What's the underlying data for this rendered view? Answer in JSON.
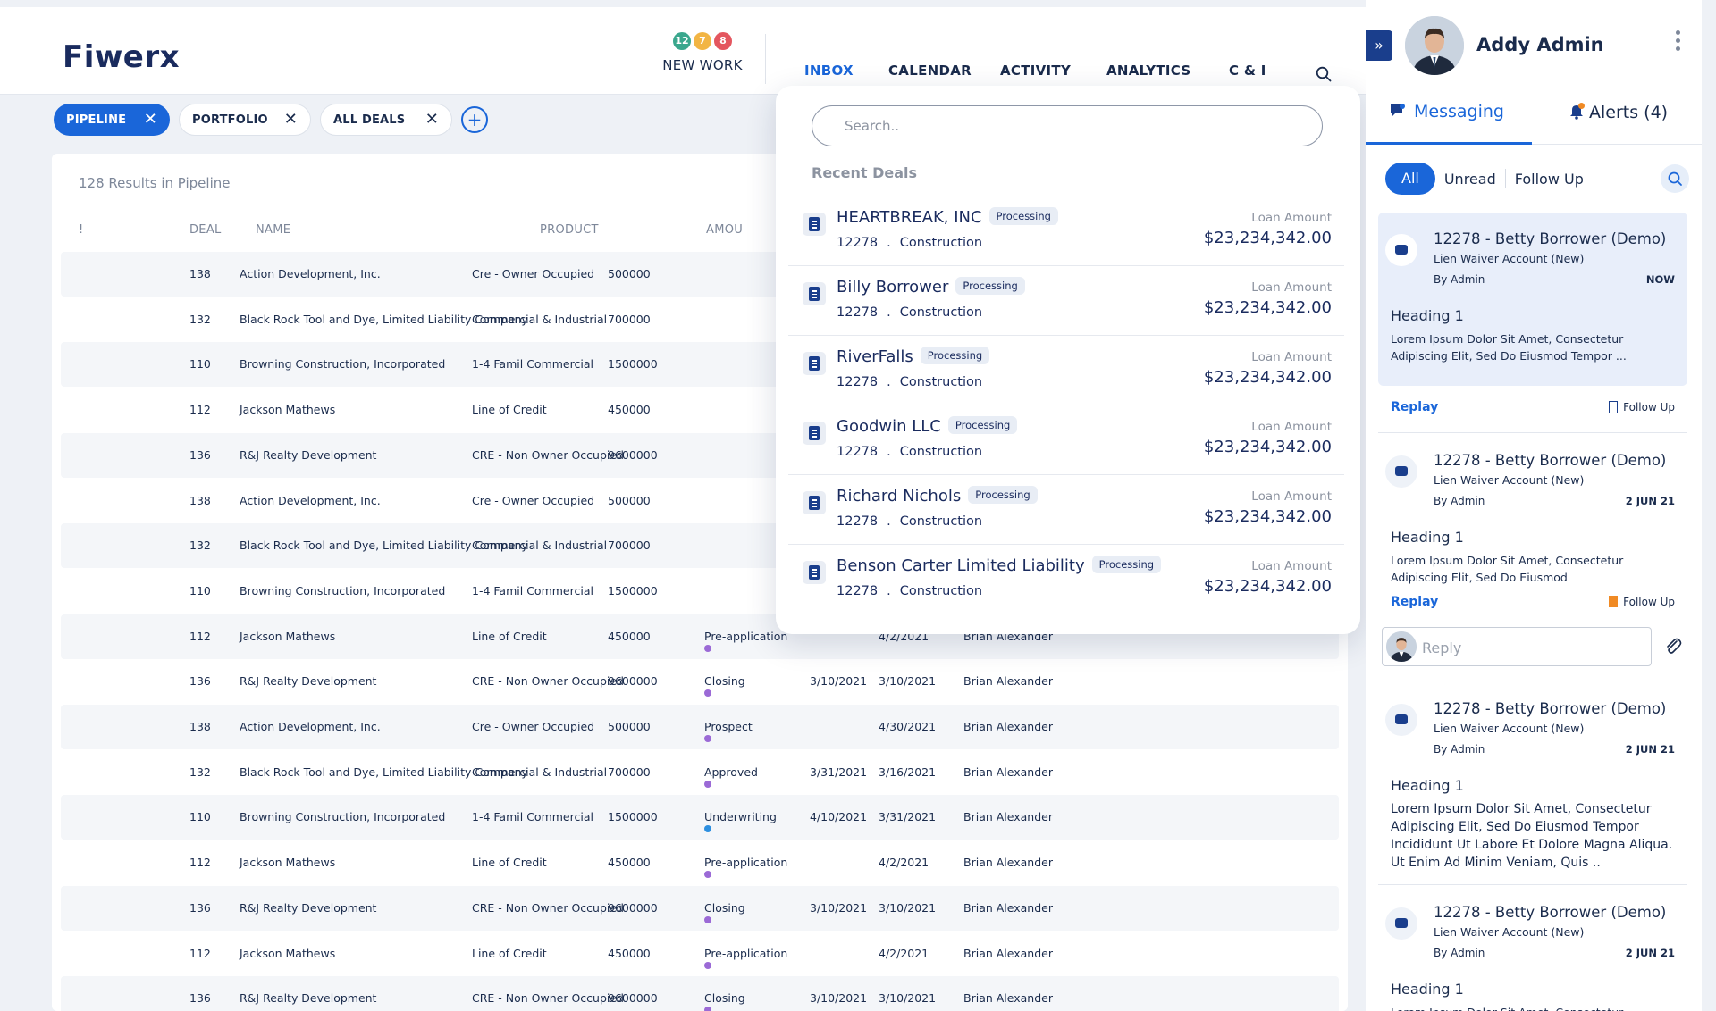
{
  "app": {
    "logo": "Fiwerx"
  },
  "header": {
    "new_work": {
      "label": "NEW WORK",
      "badges": [
        {
          "count": "12",
          "color": "#3aa78d"
        },
        {
          "count": "7",
          "color": "#f2b544"
        },
        {
          "count": "8",
          "color": "#e4565f"
        }
      ]
    },
    "tabs": [
      "INBOX",
      "CALENDAR",
      "ACTIVITY",
      "ANALYTICS",
      "C & I"
    ],
    "active_tab": "INBOX"
  },
  "filters": [
    {
      "label": "PIPELINE",
      "active": true
    },
    {
      "label": "PORTFOLIO",
      "active": false
    },
    {
      "label": "ALL DEALS",
      "active": false
    }
  ],
  "table": {
    "results": "128 Results in Pipeline",
    "columns": [
      "!",
      "DEAL",
      "NAME",
      "PRODUCT",
      "AMOU"
    ],
    "rows": [
      {
        "deal": "138",
        "name": "Action Development, Inc.",
        "product": "Cre - Owner Occupied",
        "amount": "500000",
        "status": "",
        "status_color": "",
        "date1": "",
        "date2": "",
        "owner": ""
      },
      {
        "deal": "132",
        "name": "Black Rock Tool and Dye, Limited Liability Company",
        "product": "Commercial & Industrial",
        "amount": "700000",
        "status": "",
        "status_color": "",
        "date1": "",
        "date2": "",
        "owner": ""
      },
      {
        "deal": "110",
        "name": "Browning Construction, Incorporated",
        "product": "1-4 Famil Commercial",
        "amount": "1500000",
        "status": "",
        "status_color": "",
        "date1": "",
        "date2": "",
        "owner": ""
      },
      {
        "deal": "112",
        "name": "Jackson Mathews",
        "product": "Line of Credit",
        "amount": "450000",
        "status": "",
        "status_color": "",
        "date1": "",
        "date2": "",
        "owner": ""
      },
      {
        "deal": "136",
        "name": "R&J Realty Development",
        "product": "CRE - Non Owner Occupied",
        "amount": "9600000",
        "status": "",
        "status_color": "",
        "date1": "",
        "date2": "",
        "owner": ""
      },
      {
        "deal": "138",
        "name": "Action Development, Inc.",
        "product": "Cre - Owner Occupied",
        "amount": "500000",
        "status": "",
        "status_color": "",
        "date1": "",
        "date2": "",
        "owner": ""
      },
      {
        "deal": "132",
        "name": "Black Rock Tool and Dye, Limited Liability Company",
        "product": "Commercial & Industrial",
        "amount": "700000",
        "status": "",
        "status_color": "",
        "date1": "",
        "date2": "",
        "owner": ""
      },
      {
        "deal": "110",
        "name": "Browning Construction, Incorporated",
        "product": "1-4 Famil Commercial",
        "amount": "1500000",
        "status": "",
        "status_color": "",
        "date1": "",
        "date2": "",
        "owner": ""
      },
      {
        "deal": "112",
        "name": "Jackson Mathews",
        "product": "Line of Credit",
        "amount": "450000",
        "status": "Pre-application",
        "status_color": "#9b6ad6",
        "date1": "",
        "date2": "4/2/2021",
        "owner": "Brian Alexander"
      },
      {
        "deal": "136",
        "name": "R&J Realty Development",
        "product": "CRE - Non Owner Occupied",
        "amount": "9600000",
        "status": "Closing",
        "status_color": "#9b6ad6",
        "date1": "3/10/2021",
        "date2": "3/10/2021",
        "owner": "Brian Alexander"
      },
      {
        "deal": "138",
        "name": "Action Development, Inc.",
        "product": "Cre - Owner Occupied",
        "amount": "500000",
        "status": "Prospect",
        "status_color": "#9b6ad6",
        "date1": "",
        "date2": "4/30/2021",
        "owner": "Brian Alexander"
      },
      {
        "deal": "132",
        "name": "Black Rock Tool and Dye, Limited Liability Company",
        "product": "Commercial & Industrial",
        "amount": "700000",
        "status": "Approved",
        "status_color": "#9b6ad6",
        "date1": "3/31/2021",
        "date2": "3/16/2021",
        "owner": "Brian Alexander"
      },
      {
        "deal": "110",
        "name": "Browning Construction, Incorporated",
        "product": "1-4 Famil Commercial",
        "amount": "1500000",
        "status": "Underwriting",
        "status_color": "#2d8fe0",
        "date1": "4/10/2021",
        "date2": "3/31/2021",
        "owner": "Brian Alexander"
      },
      {
        "deal": "112",
        "name": "Jackson Mathews",
        "product": "Line of Credit",
        "amount": "450000",
        "status": "Pre-application",
        "status_color": "#9b6ad6",
        "date1": "",
        "date2": "4/2/2021",
        "owner": "Brian Alexander"
      },
      {
        "deal": "136",
        "name": "R&J Realty Development",
        "product": "CRE - Non Owner Occupied",
        "amount": "9600000",
        "status": "Closing",
        "status_color": "#9b6ad6",
        "date1": "3/10/2021",
        "date2": "3/10/2021",
        "owner": "Brian Alexander"
      },
      {
        "deal": "112",
        "name": "Jackson Mathews",
        "product": "Line of Credit",
        "amount": "450000",
        "status": "Pre-application",
        "status_color": "#9b6ad6",
        "date1": "",
        "date2": "4/2/2021",
        "owner": "Brian Alexander"
      },
      {
        "deal": "136",
        "name": "R&J Realty Development",
        "product": "CRE - Non Owner Occupied",
        "amount": "9600000",
        "status": "Closing",
        "status_color": "#9b6ad6",
        "date1": "3/10/2021",
        "date2": "3/10/2021",
        "owner": "Brian Alexander"
      }
    ]
  },
  "dropdown": {
    "search_placeholder": "Search..",
    "title": "Recent Deals",
    "deals": [
      {
        "name": "HEARTBREAK, INC",
        "badge": "Processing",
        "id": "12278",
        "type": "Construction",
        "amount_label": "Loan Amount",
        "amount": "$23,234,342.00"
      },
      {
        "name": "Billy Borrower",
        "badge": "Processing",
        "id": "12278",
        "type": "Construction",
        "amount_label": "Loan Amount",
        "amount": "$23,234,342.00"
      },
      {
        "name": "RiverFalls",
        "badge": "Processing",
        "id": "12278",
        "type": "Construction",
        "amount_label": "Loan Amount",
        "amount": "$23,234,342.00"
      },
      {
        "name": "Goodwin LLC",
        "badge": "Processing",
        "id": "12278",
        "type": "Construction",
        "amount_label": "Loan Amount",
        "amount": "$23,234,342.00"
      },
      {
        "name": "Richard Nichols",
        "badge": "Processing",
        "id": "12278",
        "type": "Construction",
        "amount_label": "Loan Amount",
        "amount": "$23,234,342.00"
      },
      {
        "name": "Benson Carter Limited Liability",
        "badge": "Processing",
        "id": "12278",
        "type": "Construction",
        "amount_label": "Loan Amount",
        "amount": "$23,234,342.00"
      }
    ]
  },
  "sidebar": {
    "user_name": "Addy Admin",
    "tabs": {
      "messaging": "Messaging",
      "alerts": "Alerts (4)"
    },
    "filters": [
      "All",
      "Unread",
      "Follow Up"
    ],
    "reply_placeholder": "Reply",
    "messages": [
      {
        "title": "12278 - Betty Borrower (Demo)",
        "account": "Lien Waiver Account (New)",
        "by": "By Admin",
        "time": "NOW",
        "heading": "Heading 1",
        "body": "Lorem Ipsum Dolor Sit Amet, Consectetur Adipiscing Elit, Sed Do Eiusmod Tempor ...",
        "replay": "Replay",
        "follow": "Follow Up",
        "followed": false
      },
      {
        "title": "12278 - Betty Borrower (Demo)",
        "account": "Lien Waiver Account (New)",
        "by": "By Admin",
        "time": "2 JUN 21",
        "heading": "Heading 1",
        "body": "Lorem Ipsum Dolor Sit Amet, Consectetur Adipiscing Elit, Sed Do Eiusmod",
        "replay": "Replay",
        "follow": "Follow Up",
        "followed": true
      },
      {
        "title": "12278 - Betty Borrower (Demo)",
        "account": "Lien Waiver Account (New)",
        "by": "By Admin",
        "time": "2 JUN 21",
        "heading": "Heading 1",
        "body": "Lorem Ipsum Dolor Sit Amet, Consectetur Adipiscing Elit, Sed Do Eiusmod Tempor Incididunt Ut Labore Et Dolore Magna Aliqua. Ut Enim Ad Minim Veniam, Quis ..",
        "replay": "",
        "follow": "",
        "followed": false
      },
      {
        "title": "12278 - Betty Borrower (Demo)",
        "account": "Lien Waiver Account (New)",
        "by": "By Admin",
        "time": "2 JUN 21",
        "heading": "Heading 1",
        "body": "Lorem Ipsum Dolor Sit Amet, Consectetur",
        "replay": "",
        "follow": "",
        "followed": false
      }
    ]
  }
}
